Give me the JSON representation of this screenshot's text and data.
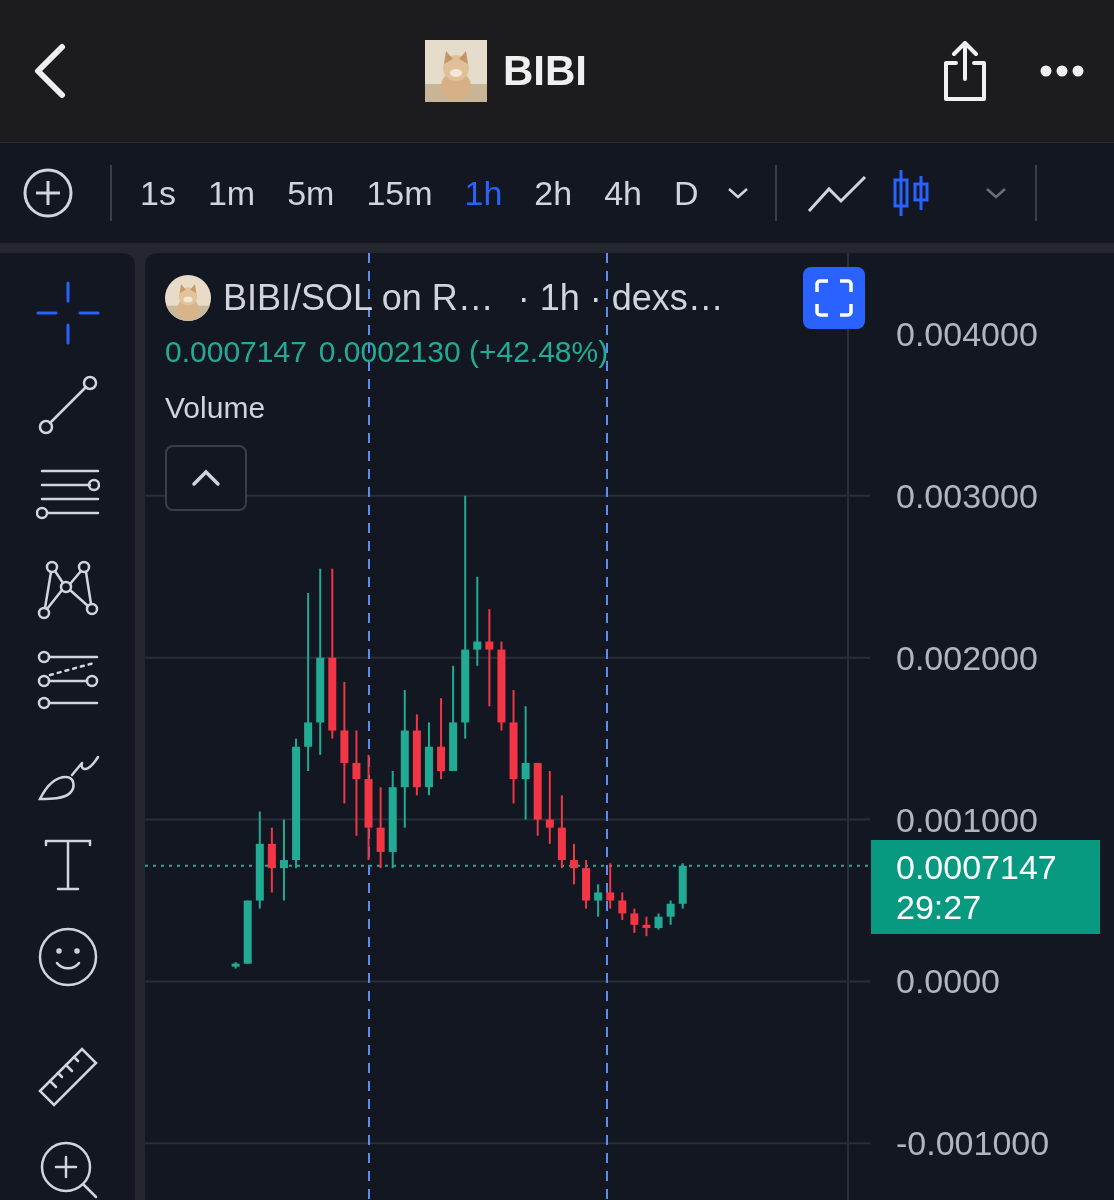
{
  "header": {
    "title": "BIBI"
  },
  "toolbar": {
    "intervals": [
      {
        "label": "1s",
        "selected": false
      },
      {
        "label": "1m",
        "selected": false
      },
      {
        "label": "5m",
        "selected": false
      },
      {
        "label": "15m",
        "selected": false
      },
      {
        "label": "1h",
        "selected": true
      },
      {
        "label": "2h",
        "selected": false
      },
      {
        "label": "4h",
        "selected": false
      },
      {
        "label": "D",
        "selected": false
      }
    ],
    "chart_types": [
      {
        "kind": "line",
        "selected": false
      },
      {
        "kind": "candles",
        "selected": true
      }
    ]
  },
  "drawing_tools": [
    {
      "kind": "crosshair",
      "selected": true
    },
    {
      "kind": "trend-line",
      "selected": false
    },
    {
      "kind": "channel",
      "selected": false
    },
    {
      "kind": "pattern",
      "selected": false
    },
    {
      "kind": "projection",
      "selected": false
    },
    {
      "kind": "brush",
      "selected": false
    },
    {
      "kind": "text",
      "selected": false
    },
    {
      "kind": "emoji",
      "selected": false
    }
  ],
  "measure_tools": [
    {
      "kind": "ruler",
      "selected": false
    },
    {
      "kind": "zoom",
      "selected": false
    }
  ],
  "chart": {
    "symbol": "BIBI/SOL on R…",
    "interval": "· 1h · dexs…",
    "last": "0.0007147",
    "change": "0.0002130 (+42.48%)",
    "indicator": "Volume",
    "price_tag": {
      "price": "0.0007147",
      "countdown": "29:27"
    },
    "chart_data": {
      "type": "candlestick",
      "ylim": [
        -0.00135,
        0.0045
      ],
      "ohlc": [
        null,
        null,
        null,
        null,
        null,
        null,
        null,
        [
          0.0001,
          0.00012,
          8e-05,
          0.00011
        ],
        [
          0.00011,
          0.0005,
          0.00011,
          0.0005
        ],
        [
          0.0005,
          0.00105,
          0.00045,
          0.00085
        ],
        [
          0.00085,
          0.00095,
          0.00055,
          0.0007
        ],
        [
          0.0007,
          0.001,
          0.0005,
          0.00075
        ],
        [
          0.00075,
          0.0015,
          0.0007,
          0.00145
        ],
        [
          0.00145,
          0.0024,
          0.0013,
          0.0016
        ],
        [
          0.0016,
          0.00255,
          0.0014,
          0.002
        ],
        [
          0.002,
          0.00255,
          0.0015,
          0.00155
        ],
        [
          0.00155,
          0.00185,
          0.0011,
          0.00135
        ],
        [
          0.00135,
          0.00155,
          0.0009,
          0.00125
        ],
        [
          0.00125,
          0.0014,
          0.00075,
          0.00095
        ],
        [
          0.00095,
          0.0012,
          0.0007,
          0.0008
        ],
        [
          0.0008,
          0.0013,
          0.0007,
          0.0012
        ],
        [
          0.0012,
          0.0018,
          0.00095,
          0.00155
        ],
        [
          0.00155,
          0.00165,
          0.00115,
          0.0012
        ],
        [
          0.0012,
          0.0016,
          0.00115,
          0.00145
        ],
        [
          0.00145,
          0.00175,
          0.00125,
          0.0013
        ],
        [
          0.0013,
          0.00195,
          0.0013,
          0.0016
        ],
        [
          0.0016,
          0.003,
          0.0015,
          0.00205
        ],
        [
          0.00205,
          0.0025,
          0.00195,
          0.0021
        ],
        [
          0.0021,
          0.0023,
          0.0017,
          0.00205
        ],
        [
          0.00205,
          0.0021,
          0.00155,
          0.0016
        ],
        [
          0.0016,
          0.0018,
          0.0011,
          0.00125
        ],
        [
          0.00125,
          0.0017,
          0.001,
          0.00135
        ],
        [
          0.00135,
          0.00135,
          0.0009,
          0.001
        ],
        [
          0.001,
          0.0013,
          0.00085,
          0.00095
        ],
        [
          0.00095,
          0.00115,
          0.0007,
          0.00075
        ],
        [
          0.00075,
          0.00085,
          0.0006,
          0.0007
        ],
        [
          0.0007,
          0.00075,
          0.00045,
          0.0005
        ],
        [
          0.0005,
          0.0006,
          0.0004,
          0.00055
        ],
        [
          0.00055,
          0.00073,
          0.00045,
          0.0005
        ],
        [
          0.0005,
          0.00055,
          0.00038,
          0.00042
        ],
        [
          0.00042,
          0.00045,
          0.0003,
          0.00035
        ],
        [
          0.00035,
          0.0004,
          0.00028,
          0.00033
        ],
        [
          0.00033,
          0.00042,
          0.00032,
          0.0004
        ],
        [
          0.0004,
          0.0005,
          0.00035,
          0.00048
        ],
        [
          0.00048,
          0.00073,
          0.00045,
          0.0007147
        ],
        null,
        null,
        null,
        null,
        null,
        null,
        null,
        null,
        null,
        null,
        null,
        null,
        null,
        null,
        null
      ],
      "grid": true,
      "ref_lines": [
        {
          "axis": "y",
          "value": 0.0007147,
          "color": "#22ab94"
        }
      ],
      "yticks": [
        {
          "value": 0.004,
          "label": "0.004000"
        },
        {
          "value": 0.003,
          "label": "0.003000"
        },
        {
          "value": 0.002,
          "label": "0.002000"
        },
        {
          "value": 0.001,
          "label": "0.001000"
        },
        {
          "value": 0,
          "label": "0.0000"
        },
        {
          "value": -0.001,
          "label": "-0.001000"
        }
      ]
    }
  }
}
